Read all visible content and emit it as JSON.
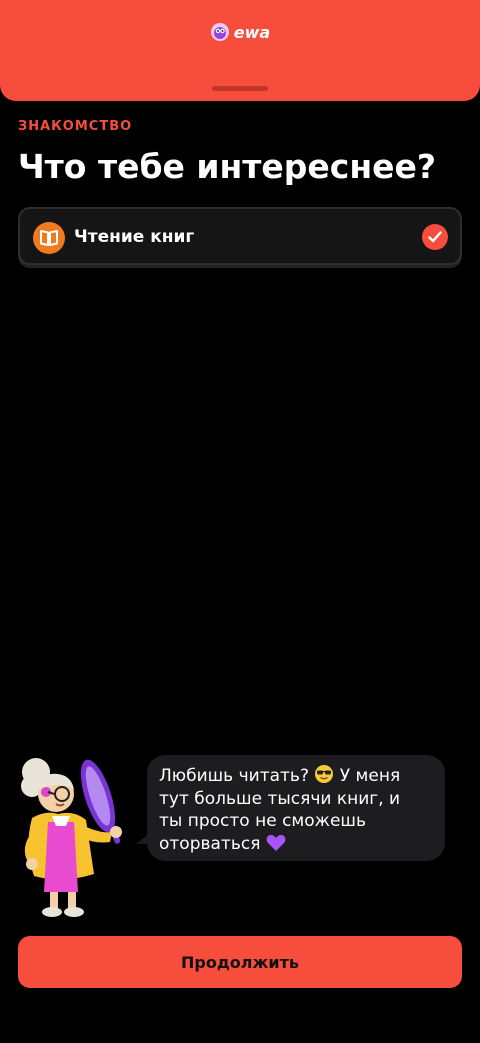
{
  "header": {
    "brand": "ewa"
  },
  "screen": {
    "eyebrow": "ЗНАКОМСТВО",
    "title": "Что тебе интереснее?"
  },
  "options": [
    {
      "label": "Чтение книг",
      "icon": "book-icon",
      "selected": true
    }
  ],
  "assistant": {
    "message_line1": "Любишь читать?",
    "message_line1b": "У меня",
    "message_rest": "тут больше тысячи книг, и\nты просто не сможешь\nоторваться",
    "emojis": [
      "sunglasses-emoji",
      "purple-heart-emoji"
    ]
  },
  "footer": {
    "continue_label": "Продолжить"
  },
  "colors": {
    "accent": "#F64D3C",
    "option_icon_bg": "#F07A1D",
    "background": "#000000",
    "bubble_bg": "#1D1D20"
  }
}
